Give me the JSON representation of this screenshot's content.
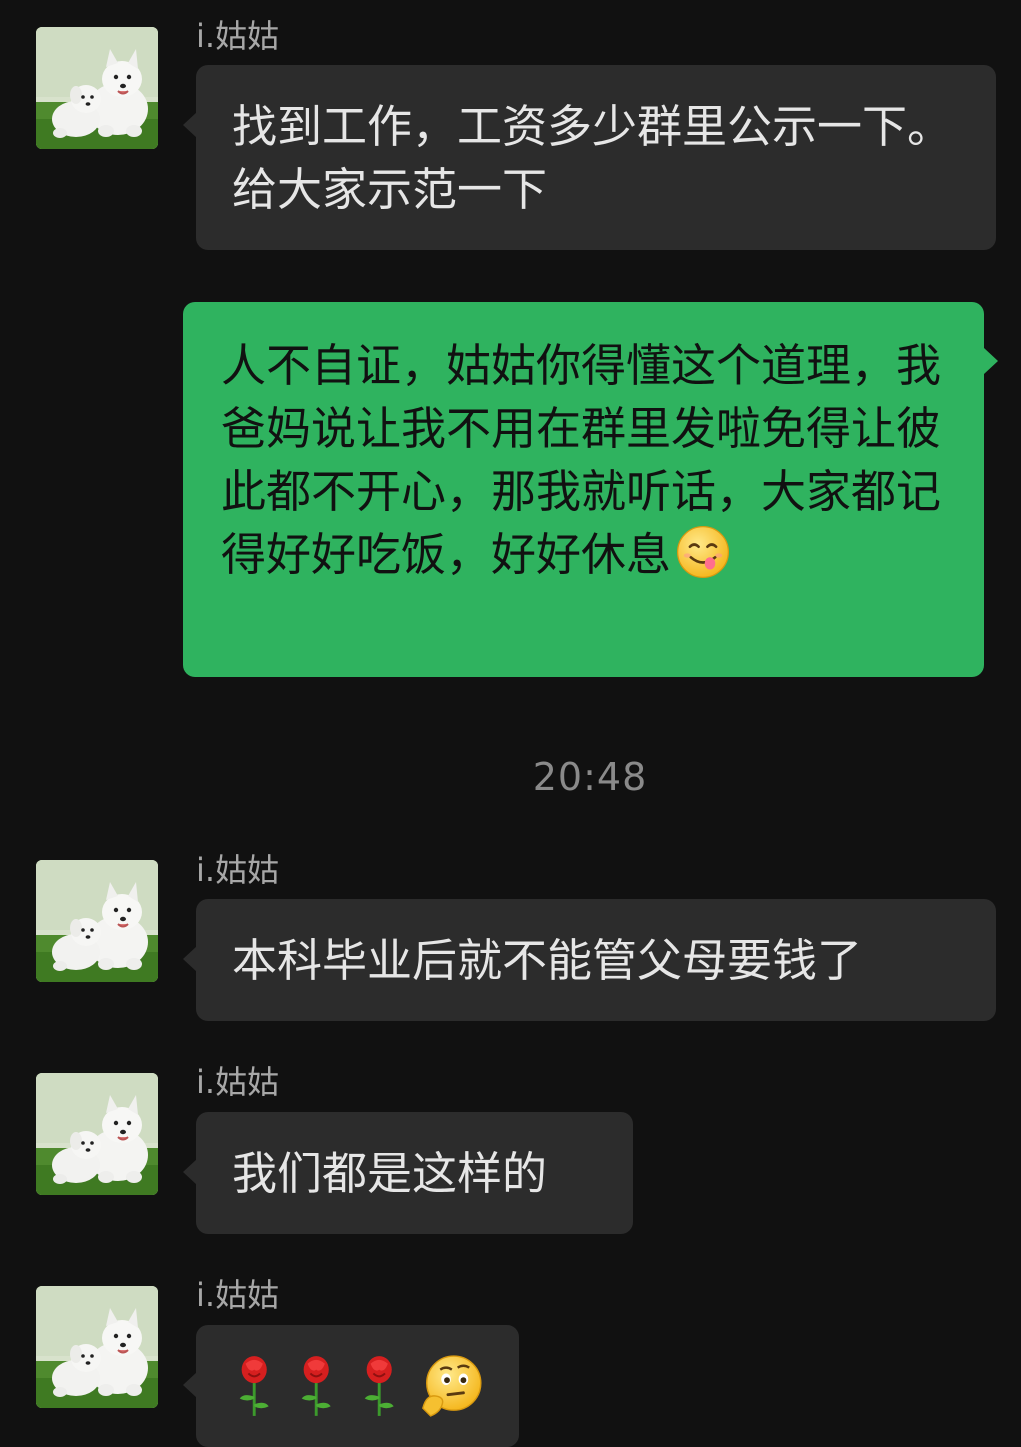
{
  "chat": {
    "messages": [
      {
        "sender": "i.姑姑",
        "direction": "incoming",
        "text": "找到工作，工资多少群里公示一下。给大家示范一下"
      },
      {
        "sender": "",
        "direction": "outgoing",
        "text": "人不自证，姑姑你得懂这个道理，我爸妈说让我不用在群里发啦免得让彼此都不开心，那我就听话，大家都记得好好吃饭，好好休息",
        "trailing_emoji": "yum-emoji"
      },
      {
        "type": "timestamp",
        "text": "20:48"
      },
      {
        "sender": "i.姑姑",
        "direction": "incoming",
        "text": "本科毕业后就不能管父母要钱了"
      },
      {
        "sender": "i.姑姑",
        "direction": "incoming",
        "text": "我们都是这样的"
      },
      {
        "sender": "i.姑姑",
        "direction": "incoming",
        "emojis": [
          "rose-emoji",
          "rose-emoji",
          "rose-emoji",
          "thinking-emoji"
        ]
      }
    ]
  },
  "colors": {
    "background": "#111111",
    "incoming_bubble": "#2c2c2c",
    "outgoing_bubble": "#2fb35f",
    "sender_text": "#a7a7a7",
    "timestamp_text": "#8a8a8a"
  }
}
